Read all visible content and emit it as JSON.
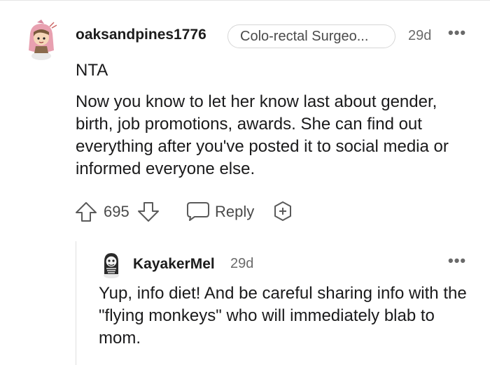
{
  "comment": {
    "username": "oaksandpines1776",
    "flair": "Colo-rectal Surgeo...",
    "time": "29d",
    "more": "•••",
    "lines": {
      "first": "NTA",
      "body": "Now you know to let her know last about gender, birth, job promotions, awards. She can find out everything after you've posted it to social media or informed everyone else."
    },
    "actions": {
      "score": "695",
      "reply_label": "Reply"
    },
    "icons": {
      "avatar": "avatar-icon",
      "upvote": "upvote-arrow-icon",
      "downvote": "downvote-arrow-icon",
      "reply": "speech-bubble-icon",
      "award": "award-plus-icon"
    }
  },
  "reply": {
    "username": "KayakerMel",
    "time": "29d",
    "more": "•••",
    "body": "Yup, info diet! And be careful sharing info with the \"flying monkeys\" who will immediately blab to mom."
  },
  "colors": {
    "text": "#1a1a1b",
    "meta": "#6a6a6a",
    "border": "#d6d6d6",
    "avatar_pink": "#e8a0b0",
    "avatar_brown": "#7a5a3c"
  }
}
